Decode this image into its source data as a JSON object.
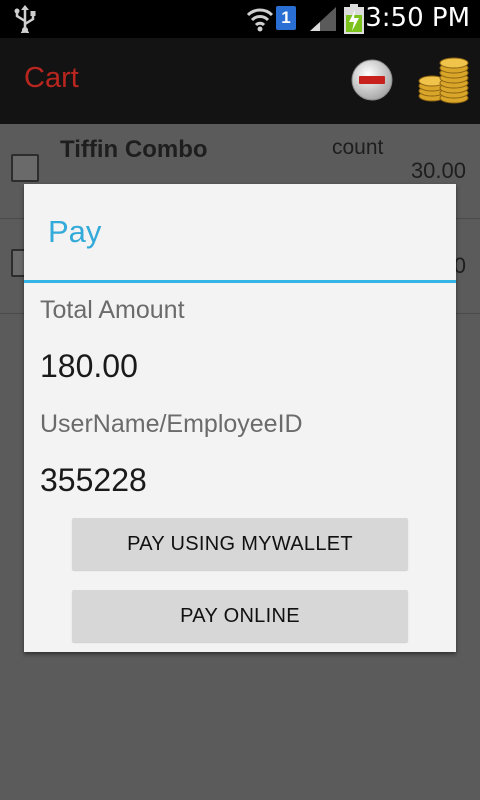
{
  "status_bar": {
    "time": "3:50 PM",
    "sim_slot": "1",
    "icons": [
      "usb-icon",
      "wifi-icon",
      "signal-icon",
      "battery-charging-icon"
    ]
  },
  "action_bar": {
    "title": "Cart",
    "title_color": "#b8261f",
    "actions": [
      "remove-icon",
      "coins-icon"
    ]
  },
  "cart": {
    "items": [
      {
        "name": "Tiffin Combo",
        "count_label": "count",
        "price": "30.00"
      },
      {
        "name": "",
        "count_label": "",
        "price": "0"
      }
    ]
  },
  "dialog": {
    "title": "Pay",
    "accent_color": "#33b5e5",
    "total_label": "Total Amount",
    "total_value": "180.00",
    "user_label": "UserName/EmployeeID",
    "user_value": "355228",
    "wallet_button": "PAY USING MYWALLET",
    "online_button": "PAY ONLINE"
  }
}
